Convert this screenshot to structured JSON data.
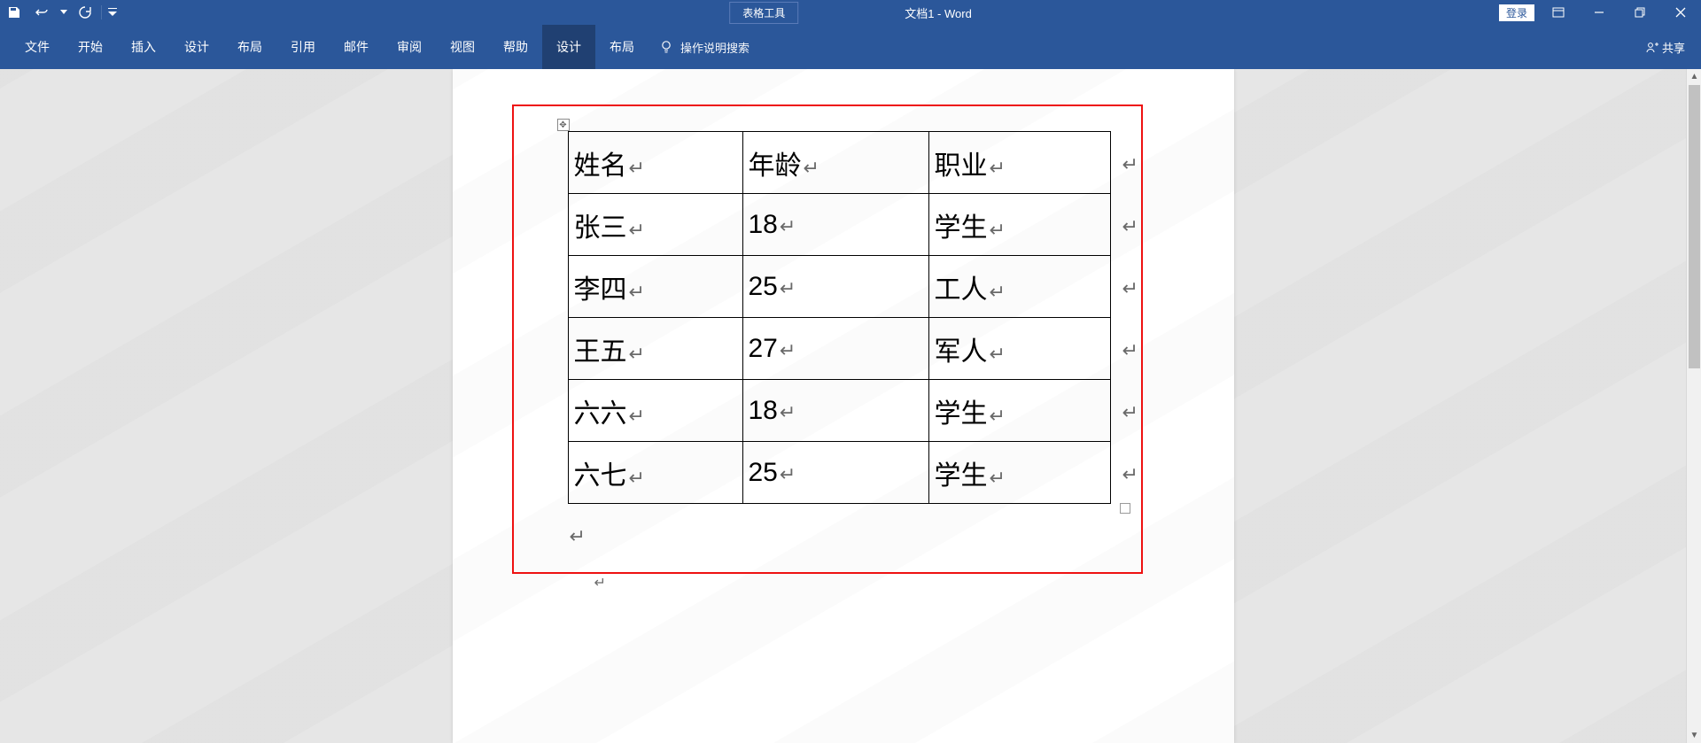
{
  "titlebar": {
    "table_tools": "表格工具",
    "document_title": "文档1 - Word",
    "login": "登录"
  },
  "ribbon": {
    "tabs": {
      "file": "文件",
      "home": "开始",
      "insert": "插入",
      "design": "设计",
      "layout": "布局",
      "references": "引用",
      "mailings": "邮件",
      "review": "审阅",
      "view": "视图",
      "help": "帮助",
      "table_design": "设计",
      "table_layout": "布局"
    },
    "tell_me": "操作说明搜索",
    "share": "共享"
  },
  "table": {
    "headers": {
      "col1": "姓名",
      "col2": "年龄",
      "col3": "职业"
    },
    "rows": [
      {
        "col1": "张三",
        "col2": "18",
        "col3": "学生"
      },
      {
        "col1": "李四",
        "col2": "25",
        "col3": "工人"
      },
      {
        "col1": "王五",
        "col2": "27",
        "col3": "军人"
      },
      {
        "col1": "六六",
        "col2": "18",
        "col3": "学生"
      },
      {
        "col1": "六七",
        "col2": "25",
        "col3": "学生"
      }
    ]
  },
  "marks": {
    "para": "↵",
    "rowend": "↵"
  }
}
